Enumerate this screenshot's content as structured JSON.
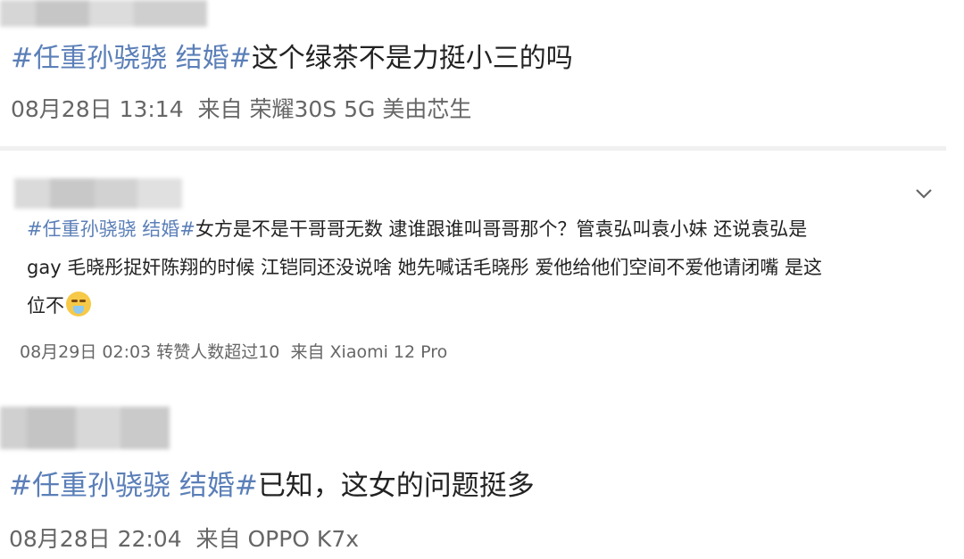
{
  "post1": {
    "hashtag": "#任重孙骁骁 结婚#",
    "body": "这个绿茶不是力挺小三的吗",
    "time": "08月28日 13:14",
    "source": "来自 荣耀30S 5G 美由芯生"
  },
  "post2": {
    "hashtag": "#任重孙骁骁 结婚#",
    "line1": "女方是不是干哥哥无数 逮谁跟谁叫哥哥那个？管袁弘叫袁小妹 还说袁弘是",
    "line2": "gay 毛晓彤捉奸陈翔的时候 江铠同还没说啥 她先喊话毛晓彤 爱他给他们空间不爱他请闭嘴 是这",
    "line3": "位不",
    "emoji_icon": "crying-face-icon",
    "time": "08月29日 02:03",
    "reposts": "转赞人数超过10",
    "source": "来自 Xiaomi 12 Pro"
  },
  "post3": {
    "hashtag": "#任重孙骁骁 结婚#",
    "body": "已知，这女的问题挺多",
    "time": "08月28日 22:04",
    "source": "来自 OPPO K7x"
  },
  "colors": {
    "hashtag": "#5b7fb8",
    "meta": "#666666",
    "separator": "#f0f0f0"
  }
}
